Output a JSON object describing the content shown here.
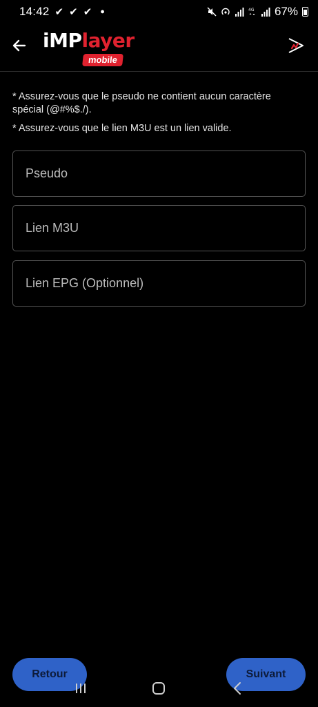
{
  "status_bar": {
    "time": "14:42",
    "battery": "67%"
  },
  "app": {
    "logo_prefix": "iMP",
    "logo_suffix": "layer",
    "logo_sub": "mobile",
    "brand_color": "#e0222f"
  },
  "info": {
    "line1": "* Assurez-vous que le pseudo ne contient aucun caractère spécial (@#%$./).",
    "line2": "* Assurez-vous que le lien M3U est un lien valide."
  },
  "form": {
    "pseudo": {
      "placeholder": "Pseudo",
      "value": ""
    },
    "m3u": {
      "placeholder": "Lien M3U",
      "value": ""
    },
    "epg": {
      "placeholder": "Lien EPG (Optionnel)",
      "value": ""
    }
  },
  "buttons": {
    "back": "Retour",
    "next": "Suivant",
    "color": "#2f62c8"
  },
  "icons": {
    "back": "arrow-left-icon",
    "cast": "cast-icon",
    "nav_recents": "recents-icon",
    "nav_home": "home-icon",
    "nav_back": "nav-back-icon"
  }
}
